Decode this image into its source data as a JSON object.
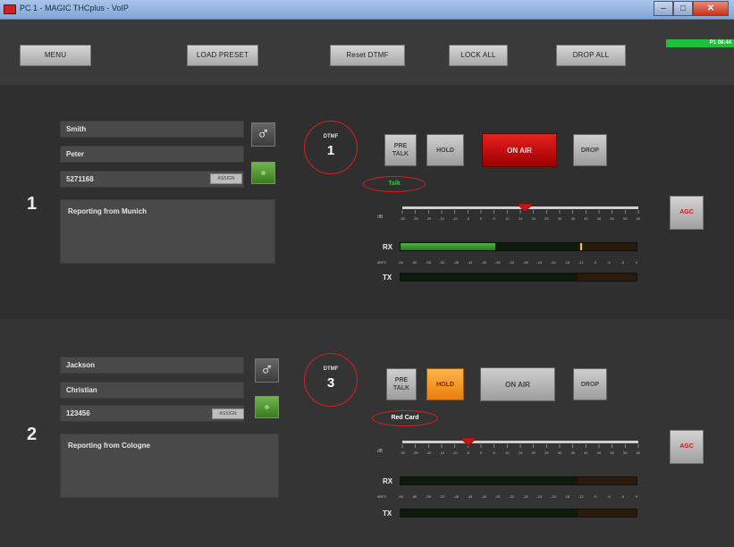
{
  "window": {
    "title": "PC 1 - MAGIC THCplus - VoIP",
    "clock": "P1 08:44"
  },
  "toolbar": {
    "menu": "MENU",
    "load_preset": "LOAD PRESET",
    "reset_dtmf": "Reset DTMF",
    "lock_all": "LOCK ALL",
    "drop_all": "DROP ALL"
  },
  "channels": [
    {
      "number": "1",
      "last_name": "Smith",
      "first_name": "Peter",
      "phone": "5271168",
      "assign_label": "ASSIGN",
      "comment": "Reporting from Munich",
      "dtmf_label": "DTMF",
      "dtmf_value": "1",
      "pretalk": "PRE TALK",
      "hold": "HOLD",
      "onair": "ON AIR",
      "drop": "DROP",
      "agc": "AGC",
      "status_text": "Talk",
      "status_color": "#3fbf3f",
      "hold_active": false,
      "onair_active": true,
      "fader_level": 0.52,
      "rx_level": 0.4,
      "tx_level": 0.0,
      "rx_peak": 0.76
    },
    {
      "number": "2",
      "last_name": "Jackson",
      "first_name": "Christian",
      "phone": "123456",
      "assign_label": "ASSIGN",
      "comment": "Reporting from Cologne",
      "dtmf_label": "DTMF",
      "dtmf_value": "3",
      "pretalk": "PRE TALK",
      "hold": "HOLD",
      "onair": "ON AIR",
      "drop": "DROP",
      "agc": "AGC",
      "status_text": "Red Card",
      "status_color": "#ffffff",
      "hold_active": true,
      "onair_active": false,
      "fader_level": 0.28,
      "rx_level": 0.0,
      "tx_level": 0.0,
      "rx_peak": 0.0
    }
  ],
  "meter": {
    "rx_label": "RX",
    "tx_label": "TX",
    "fader_scale_label": "dB",
    "meter_scale_label": "dBFS",
    "fader_ticks": [
      "-30",
      "-25",
      "-20",
      "-15",
      "-10",
      "-5",
      "0",
      "5",
      "10",
      "15",
      "20",
      "25",
      "30",
      "35",
      "40",
      "45",
      "50",
      "55",
      "60"
    ],
    "meter_ticks": [
      "-64",
      "-60",
      "-56",
      "-52",
      "-48",
      "-44",
      "-40",
      "-36",
      "-32",
      "-28",
      "-24",
      "-20",
      "-16",
      "-12",
      "-9",
      "-6",
      "-3",
      "0"
    ]
  },
  "colors": {
    "accent_red": "#d62020",
    "onair_red": "#cc0000",
    "hold_orange": "#f08a14",
    "meter_green": "#3fa62f",
    "title_blue": "#8fb0dc"
  }
}
